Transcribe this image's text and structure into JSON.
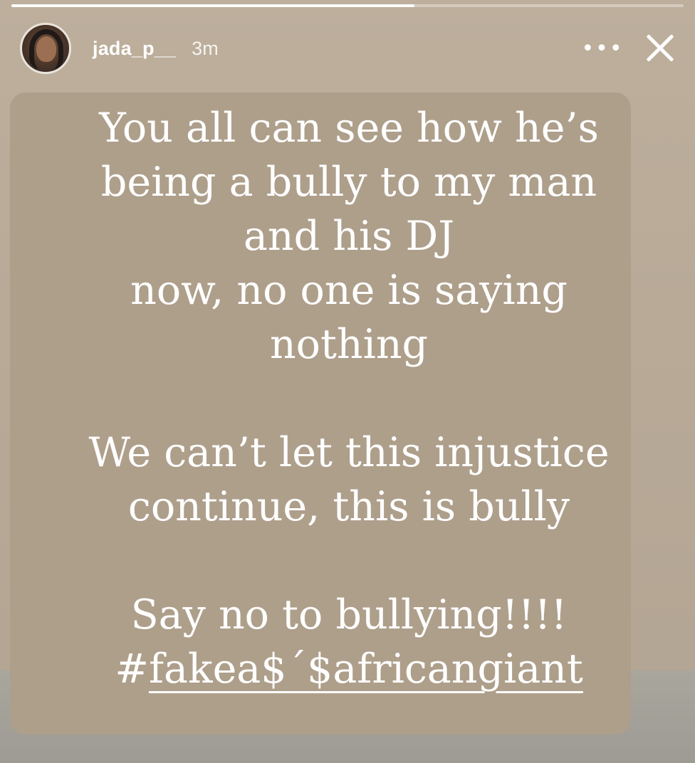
{
  "story": {
    "username": "jada_p__",
    "time": "3m",
    "more_label": "•••",
    "progress": 0.6,
    "lines_para1": [
      "You all can see how he’s",
      "being a bully to my man",
      "and his DJ",
      "now, no one is saying",
      "nothing"
    ],
    "lines_para2": [
      "We can’t let this injustice",
      "continue, this is bully"
    ],
    "line_para3": "Say no to bullying!!!!",
    "hashtag": {
      "prefix": "#",
      "underlined": "fakea$ˊ$africangiant"
    }
  },
  "icons": {
    "close": "close-icon",
    "more": "more-options-icon",
    "avatar": "profile-avatar"
  },
  "colors": {
    "background": "#b9ab98",
    "text": "#ffffff"
  }
}
